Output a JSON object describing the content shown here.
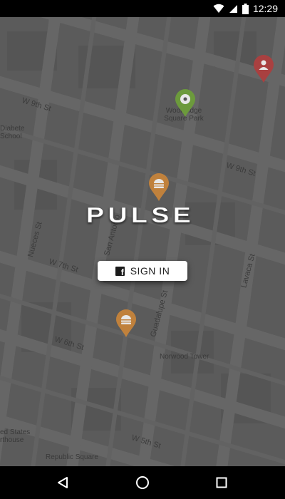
{
  "status_bar": {
    "time": "12:29",
    "icons": [
      "wifi-icon",
      "cell-signal-icon",
      "battery-icon"
    ]
  },
  "map": {
    "streets": [
      "W 9th St",
      "W 9th St",
      "W 7th St",
      "W 6th St",
      "W 5th St",
      "Nueces St",
      "San Antonio",
      "Guadalupe St",
      "Lavaca St"
    ],
    "places": [
      "Wooldridge Square Park",
      "Diabete School",
      "Norwood Tower",
      "ed States rthouse",
      "Republic Square"
    ],
    "markers": [
      {
        "name": "user-marker",
        "color": "#b13a3a"
      },
      {
        "name": "soccer-marker",
        "color": "#6aa33a"
      },
      {
        "name": "burger-marker",
        "color": "#c98438"
      },
      {
        "name": "burger-marker",
        "color": "#c98438"
      }
    ]
  },
  "brand": {
    "name": "PULSE"
  },
  "signin": {
    "label": "SIGN IN",
    "icon": "facebook-icon"
  },
  "nav": {
    "buttons": [
      "back-icon",
      "home-icon",
      "recents-icon"
    ]
  }
}
